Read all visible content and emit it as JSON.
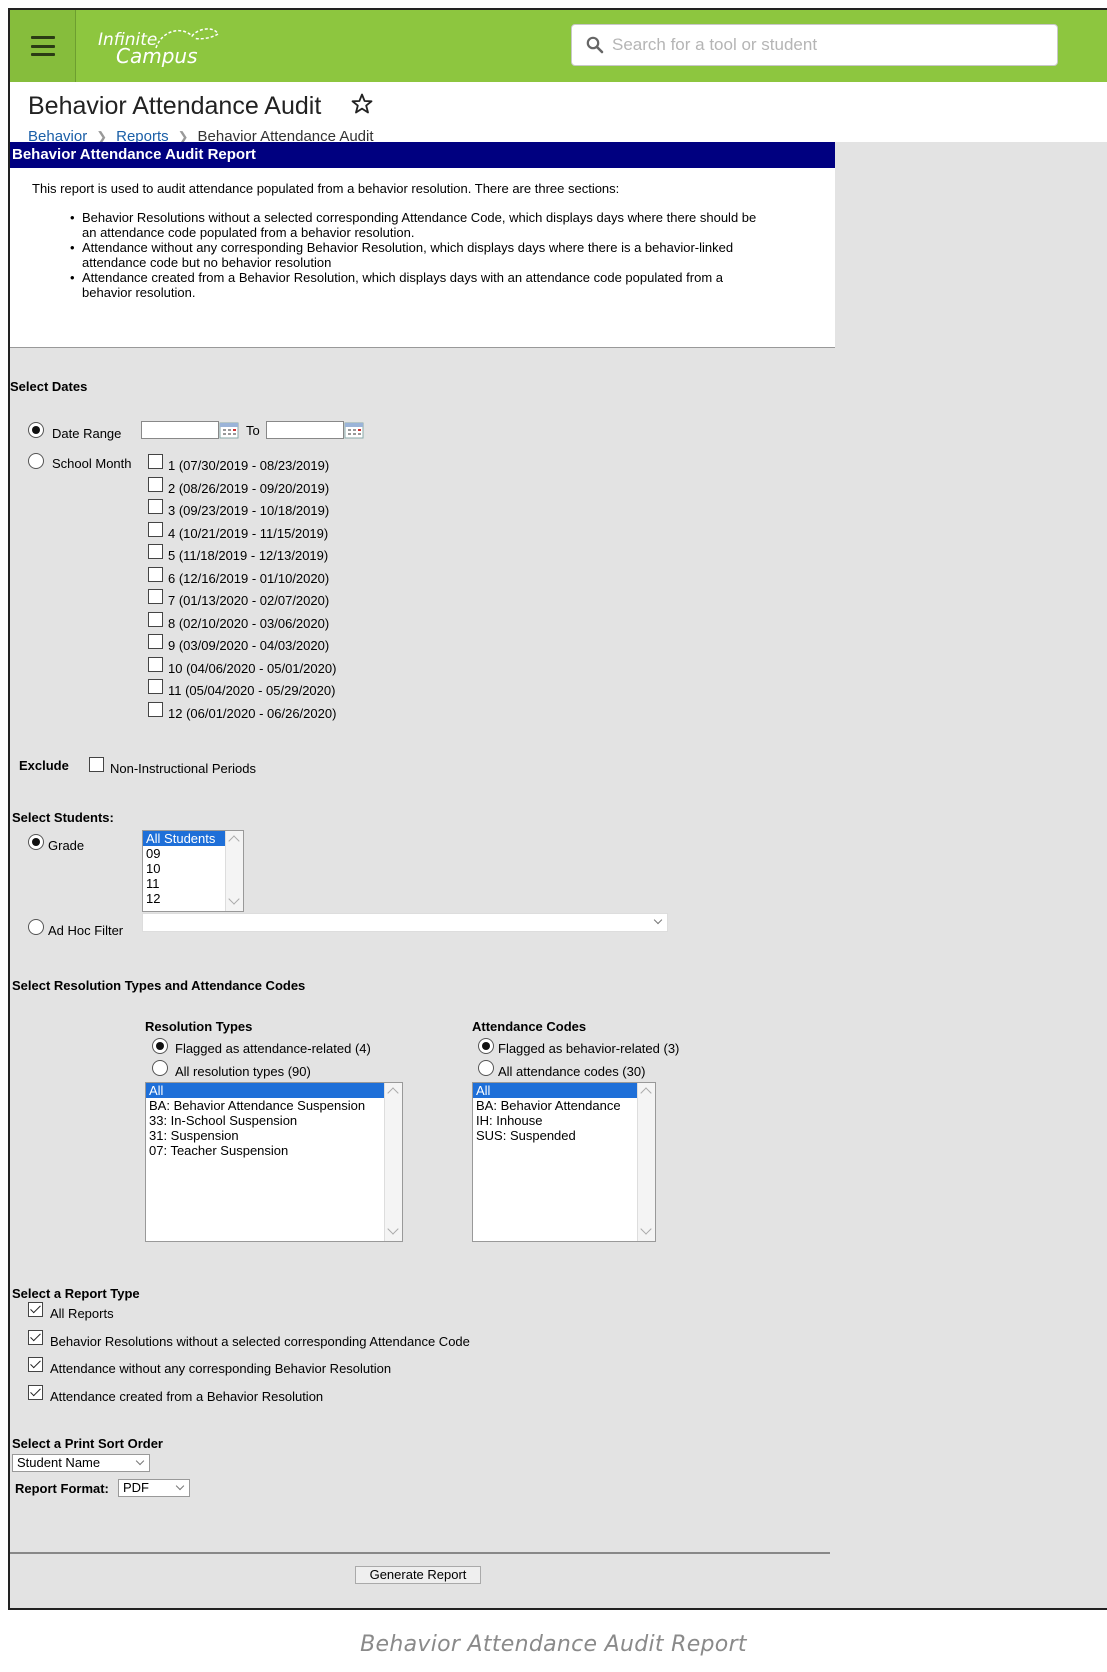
{
  "app": {
    "logo_line1": "Infinite",
    "logo_line2": "Campus",
    "search_placeholder": "Search for a tool or student"
  },
  "header": {
    "title": "Behavior Attendance Audit",
    "breadcrumbs": [
      "Behavior",
      "Reports",
      "Behavior Attendance Audit"
    ]
  },
  "report": {
    "panel_title": "Behavior Attendance Audit Report",
    "intro": "This report is used to audit attendance populated from a behavior resolution. There are three sections:",
    "bullets": [
      [
        "Behavior Resolutions without a selected corresponding Attendance Code, which displays days where there should be",
        "an attendance code populated from a behavior resolution."
      ],
      [
        "Attendance without any corresponding Behavior Resolution, which displays days where there is a behavior-linked",
        "attendance code but no behavior resolution"
      ],
      [
        "Attendance created from a Behavior Resolution, which displays days with an attendance code populated from a",
        "behavior resolution."
      ]
    ]
  },
  "dates": {
    "section_label": "Select Dates",
    "date_range_label": "Date Range",
    "to_label": "To",
    "school_month_label": "School Month",
    "selected": "Date Range",
    "months": [
      "1 (07/30/2019 - 08/23/2019)",
      "2 (08/26/2019 - 09/20/2019)",
      "3 (09/23/2019 - 10/18/2019)",
      "4 (10/21/2019 - 11/15/2019)",
      "5 (11/18/2019 - 12/13/2019)",
      "6 (12/16/2019 - 01/10/2020)",
      "7 (01/13/2020 - 02/07/2020)",
      "8 (02/10/2020 - 03/06/2020)",
      "9 (03/09/2020 - 04/03/2020)",
      "10 (04/06/2020 - 05/01/2020)",
      "11 (05/04/2020 - 05/29/2020)",
      "12 (06/01/2020 - 06/26/2020)"
    ]
  },
  "exclude": {
    "label": "Exclude",
    "option": "Non-Instructional Periods"
  },
  "students": {
    "section_label": "Select Students:",
    "grade_label": "Grade",
    "ad_hoc_label": "Ad Hoc Filter",
    "grades": [
      "All Students",
      "09",
      "10",
      "11",
      "12"
    ]
  },
  "resolution": {
    "section_label": "Select Resolution Types and Attendance Codes",
    "types_heading": "Resolution Types",
    "types_flagged": "Flagged as attendance-related (4)",
    "types_all": "All resolution types (90)",
    "types_list": [
      "All",
      "BA: Behavior Attendance Suspension",
      "33: In-School Suspension",
      "31: Suspension",
      "07: Teacher Suspension"
    ],
    "codes_heading": "Attendance Codes",
    "codes_flagged": "Flagged as behavior-related (3)",
    "codes_all": "All attendance codes (30)",
    "codes_list": [
      "All",
      "BA: Behavior Attendance",
      "IH: Inhouse",
      "SUS: Suspended"
    ]
  },
  "report_type": {
    "section_label": "Select a Report Type",
    "options": [
      "All Reports",
      "Behavior Resolutions without a selected corresponding Attendance Code",
      "Attendance without any corresponding Behavior Resolution",
      "Attendance created from a Behavior Resolution"
    ]
  },
  "sort": {
    "section_label": "Select a Print Sort Order",
    "value": "Student Name",
    "format_label": "Report Format:",
    "format_value": "PDF"
  },
  "generate_label": "Generate Report",
  "caption": "Behavior Attendance Audit Report",
  "colors": {
    "topbar": "#8dc63f",
    "panel_title_bg": "#000080",
    "link": "#1a5fa8",
    "selection": "#1e6fd8"
  }
}
